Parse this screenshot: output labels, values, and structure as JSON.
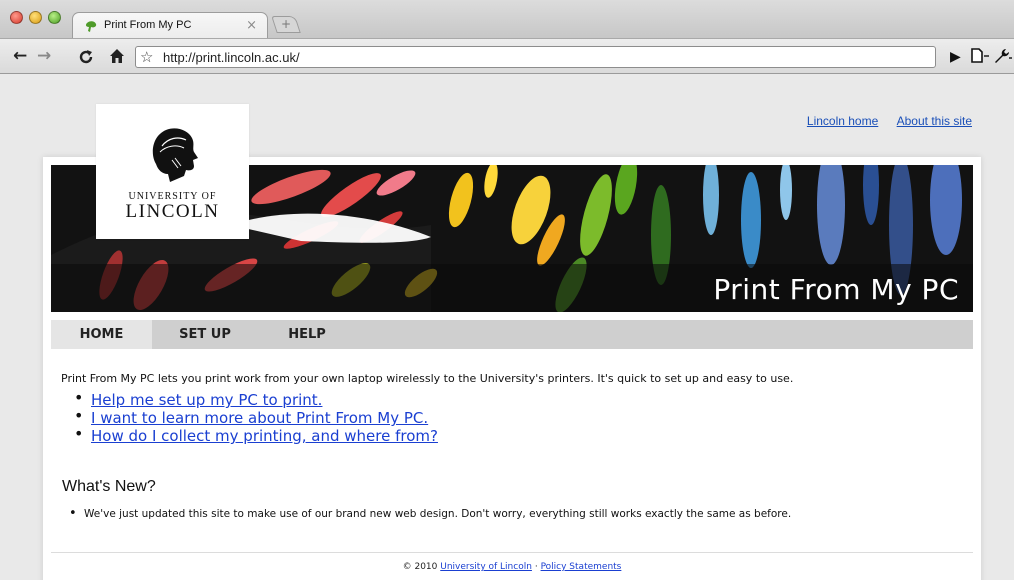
{
  "browser": {
    "tab_title": "Print From My PC",
    "tab_close": "×",
    "new_tab": "+",
    "url": "http://print.lincoln.ac.uk/",
    "icons": [
      "back-icon",
      "forward-icon",
      "reload-icon",
      "home-icon",
      "bookmark-star-icon",
      "play-icon",
      "page-menu-icon",
      "wrench-icon"
    ]
  },
  "top_links": {
    "lincoln_home": "Lincoln home",
    "about": "About this site"
  },
  "logo": {
    "line1": "UNIVERSITY OF",
    "line2": "LINCOLN"
  },
  "banner": {
    "title": "Print From My PC"
  },
  "menu": {
    "items": [
      {
        "label": "HOME",
        "active": true
      },
      {
        "label": "SET UP",
        "active": false
      },
      {
        "label": "HELP",
        "active": false
      }
    ]
  },
  "main": {
    "intro": "Print From My PC lets you print work from your own laptop wirelessly to the University's printers. It's quick to set up and easy to use.",
    "links": [
      "Help me set up my PC to print.",
      "I want to learn more about Print From My PC.",
      "How do I collect my printing, and where from?"
    ],
    "whats_new_heading": "What's New?",
    "news": [
      "We've just updated this site to make use of our brand new web design. Don't worry, everything still works exactly the same as before."
    ]
  },
  "footer": {
    "copyright": "© 2010",
    "university_link": "University of Lincoln",
    "separator": "·",
    "policy_link": "Policy Statements"
  }
}
